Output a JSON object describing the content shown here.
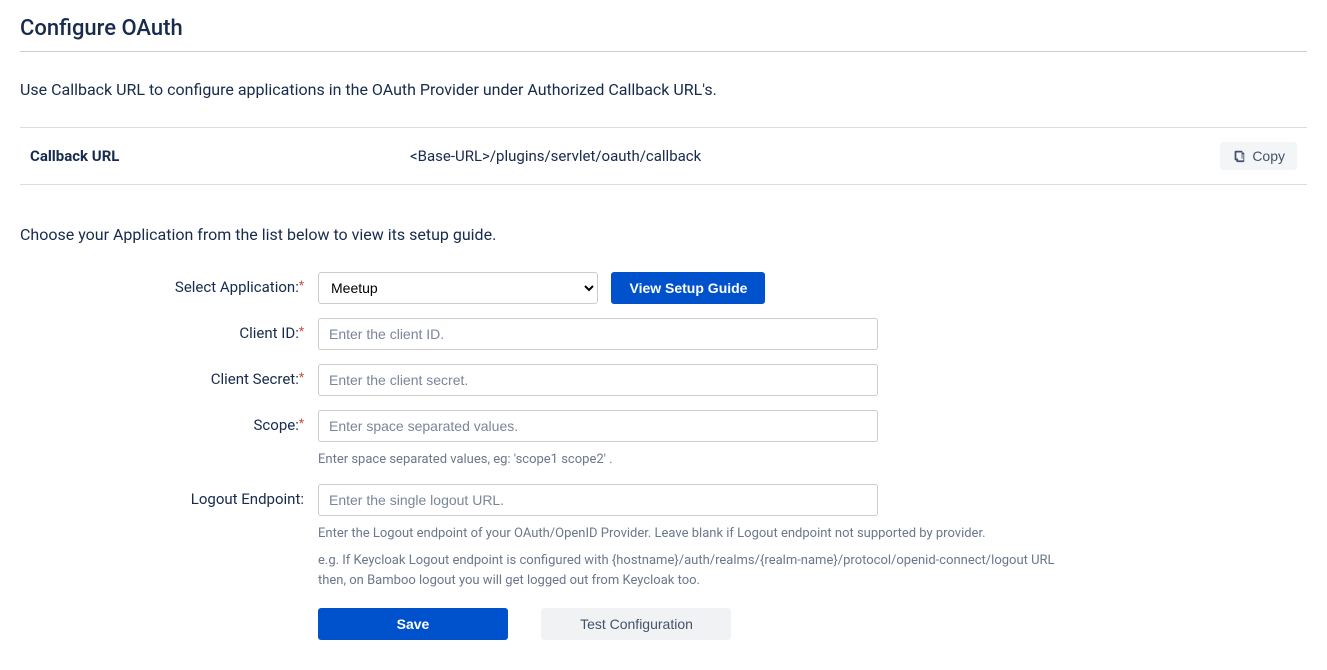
{
  "page": {
    "title": "Configure OAuth",
    "intro": "Use Callback URL to configure applications in the OAuth Provider under Authorized Callback URL's.",
    "subintro": "Choose your Application from the list below to view its setup guide."
  },
  "callback": {
    "label": "Callback URL",
    "url": "<Base-URL>/plugins/servlet/oauth/callback",
    "copy_label": "Copy"
  },
  "form": {
    "select_app": {
      "label": "Select Application:",
      "value": "Meetup"
    },
    "view_guide_label": "View Setup Guide",
    "client_id": {
      "label": "Client ID:",
      "placeholder": "Enter the client ID."
    },
    "client_secret": {
      "label": "Client Secret:",
      "placeholder": "Enter the client secret."
    },
    "scope": {
      "label": "Scope:",
      "placeholder": "Enter space separated values.",
      "help": "Enter space separated values, eg: 'scope1 scope2' ."
    },
    "logout_endpoint": {
      "label": "Logout Endpoint:",
      "placeholder": "Enter the single logout URL.",
      "help1": "Enter the Logout endpoint of your OAuth/OpenID Provider. Leave blank if Logout endpoint not supported by provider.",
      "help2": "e.g. If Keycloak Logout endpoint is configured with {hostname}/auth/realms/{realm-name}/protocol/openid-connect/logout URL then, on Bamboo logout you will get logged out from Keycloak too."
    },
    "save_label": "Save",
    "test_config_label": "Test Configuration"
  }
}
